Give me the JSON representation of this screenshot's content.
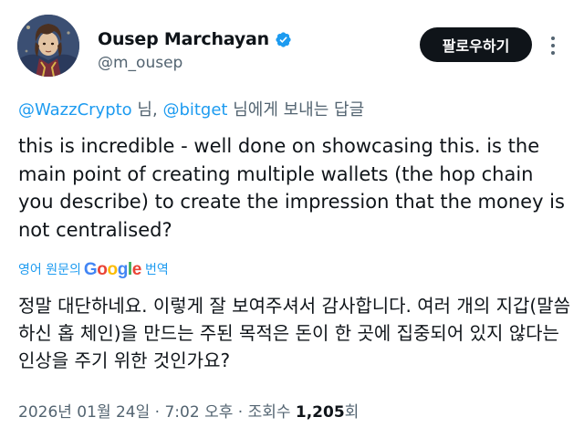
{
  "author": {
    "display_name": "Ousep Marchayan",
    "handle": "@m_ousep",
    "verified": true
  },
  "follow_button": {
    "label": "팔로우하기"
  },
  "reply_context": {
    "mention1": "@WazzCrypto",
    "sep1": " 님, ",
    "mention2": "@bitget",
    "suffix": " 님에게 보내는 답글"
  },
  "tweet": {
    "text": "this is incredible - well done on showcasing this. is the main point of creating multiple wallets (the hop chain you describe) to create the impression that the money is not centralised?",
    "translate_prefix": "영어 원문의",
    "translate_brand": "Google",
    "translate_suffix": "번역",
    "translated_text": "정말 대단하네요. 이렇게 잘 보여주셔서 감사합니다. 여러 개의 지갑(말씀하신 홉 체인)을 만드는 주된 목적은 돈이 한 곳에 집중되어 있지 않다는 인상을 주기 위한 것인가요?"
  },
  "meta": {
    "date": "2026년 01월 24일",
    "time": "7:02 오후",
    "views_label": "조회수",
    "views_count": "1,205",
    "views_unit": "회",
    "separator": " · "
  },
  "colors": {
    "accent": "#1d9bf0",
    "text_primary": "#0f1419",
    "text_secondary": "#536471",
    "button_bg": "#0f1419"
  },
  "icons": {
    "verified": "verified-badge-icon",
    "more": "more-horizontal-icon"
  }
}
